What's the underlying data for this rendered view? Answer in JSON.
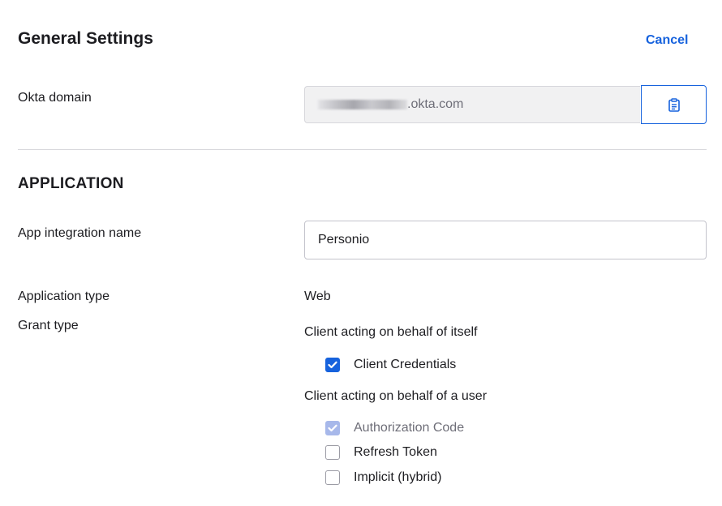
{
  "header": {
    "title": "General Settings",
    "cancel_label": "Cancel"
  },
  "okta_domain": {
    "label": "Okta domain",
    "value_suffix": ".okta.com",
    "copy_icon": "clipboard-icon"
  },
  "application": {
    "section_title": "APPLICATION",
    "integration_name_label": "App integration name",
    "integration_name_value": "Personio",
    "type_label": "Application type",
    "type_value": "Web",
    "grant_type_label": "Grant type",
    "grant_groups": [
      {
        "heading": "Client acting on behalf of itself",
        "options": [
          {
            "label": "Client Credentials",
            "state": "checked"
          }
        ]
      },
      {
        "heading": "Client acting on behalf of a user",
        "options": [
          {
            "label": "Authorization Code",
            "state": "checked-disabled"
          },
          {
            "label": "Refresh Token",
            "state": "unchecked"
          },
          {
            "label": "Implicit (hybrid)",
            "state": "unchecked"
          }
        ]
      }
    ]
  },
  "colors": {
    "accent": "#1662dd",
    "disabled_check": "#a7b8ea",
    "divider": "#d7d7dc"
  }
}
